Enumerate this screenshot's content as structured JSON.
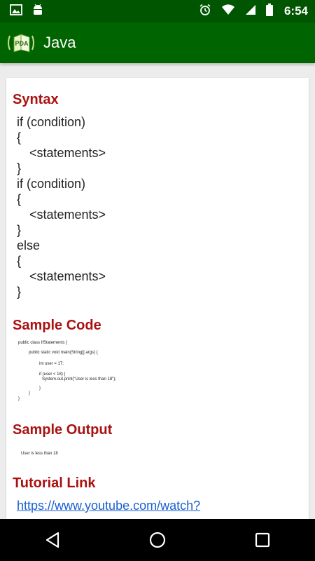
{
  "status_bar": {
    "time": "6:54",
    "icons_left": [
      "image-icon",
      "android-icon"
    ],
    "icons_right": [
      "alarm-icon",
      "wifi-icon",
      "signal-icon",
      "battery-icon"
    ]
  },
  "app_bar": {
    "logo_text": "PDA",
    "title": "Java"
  },
  "syntax": {
    "title": "Syntax",
    "lines": [
      "if (condition)",
      "{",
      "<statements>",
      "}",
      "if (condition)",
      "{",
      "<statements>",
      "}",
      "else",
      "{",
      "<statements>",
      "}"
    ]
  },
  "sample_code": {
    "title": "Sample Code",
    "lines": [
      "public class IfStatements {",
      "public static void main(String[] args) {",
      "int user = 17;",
      "if (user < 18) {",
      "System.out.print(\"User is less than 18\");",
      "}",
      "}",
      "}"
    ]
  },
  "sample_output": {
    "title": "Sample Output",
    "text": "User is less than 18"
  },
  "tutorial": {
    "title": "Tutorial Link",
    "link": "https://www.youtube.com/watch?"
  },
  "colors": {
    "status_bar": "#005500",
    "app_bar": "#006400",
    "section_title": "#aa1111",
    "link": "#1a5fd0"
  }
}
